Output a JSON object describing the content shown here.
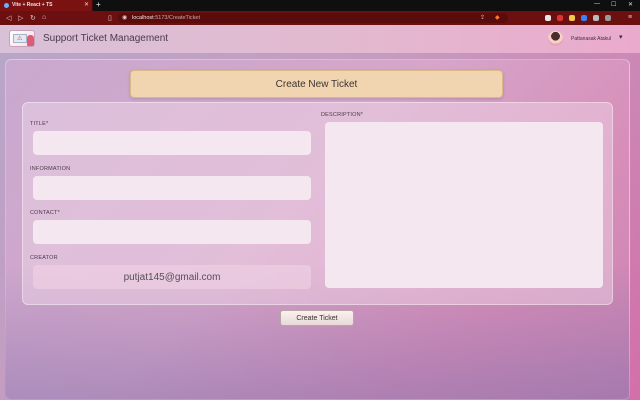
{
  "browser": {
    "tab_title": "Vite + React + TS",
    "url_host": "localhost",
    "url_path": ":5173/CreateTicket"
  },
  "app": {
    "title": "Support Ticket Management",
    "user_name": "Pattanasak Atakul"
  },
  "form": {
    "heading": "Create New Ticket",
    "title_label": "TITLE*",
    "title_value": "",
    "information_label": "INFORMATION",
    "information_value": "",
    "contact_label": "CONTACT*",
    "contact_value": "",
    "creator_label": "CREATOR",
    "creator_value": "putjat145@gmail.com",
    "description_label": "DESCRIPTION*",
    "description_value": "",
    "submit_label": "Create Ticket"
  },
  "colors": {
    "accent_header": "#f0d5b0",
    "browser_tab": "#7a1212"
  }
}
